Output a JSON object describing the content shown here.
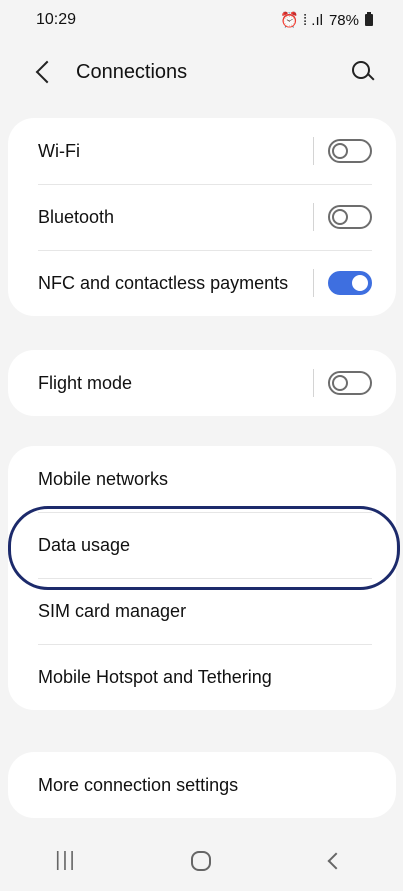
{
  "status_bar": {
    "time": "10:29",
    "indicators": "⏰ ⁞ .ıl",
    "battery": "78%"
  },
  "header": {
    "title": "Connections"
  },
  "sections": {
    "group1": [
      {
        "label": "Wi-Fi",
        "toggle": "off"
      },
      {
        "label": "Bluetooth",
        "toggle": "off"
      },
      {
        "label": "NFC and contactless payments",
        "toggle": "on"
      }
    ],
    "group2": [
      {
        "label": "Flight mode",
        "toggle": "off"
      }
    ],
    "group3": [
      {
        "label": "Mobile networks"
      },
      {
        "label": "Data usage"
      },
      {
        "label": "SIM card manager"
      },
      {
        "label": "Mobile Hotspot and Tethering"
      }
    ],
    "group4": [
      {
        "label": "More connection settings"
      }
    ]
  },
  "icons": {
    "back": "back-icon",
    "search": "search-icon",
    "alarm": "alarm-icon",
    "signal": "signal-icon",
    "battery": "battery-icon"
  },
  "colors": {
    "toggle_on": "#3e6fe0",
    "highlight": "#1c2a6b"
  }
}
